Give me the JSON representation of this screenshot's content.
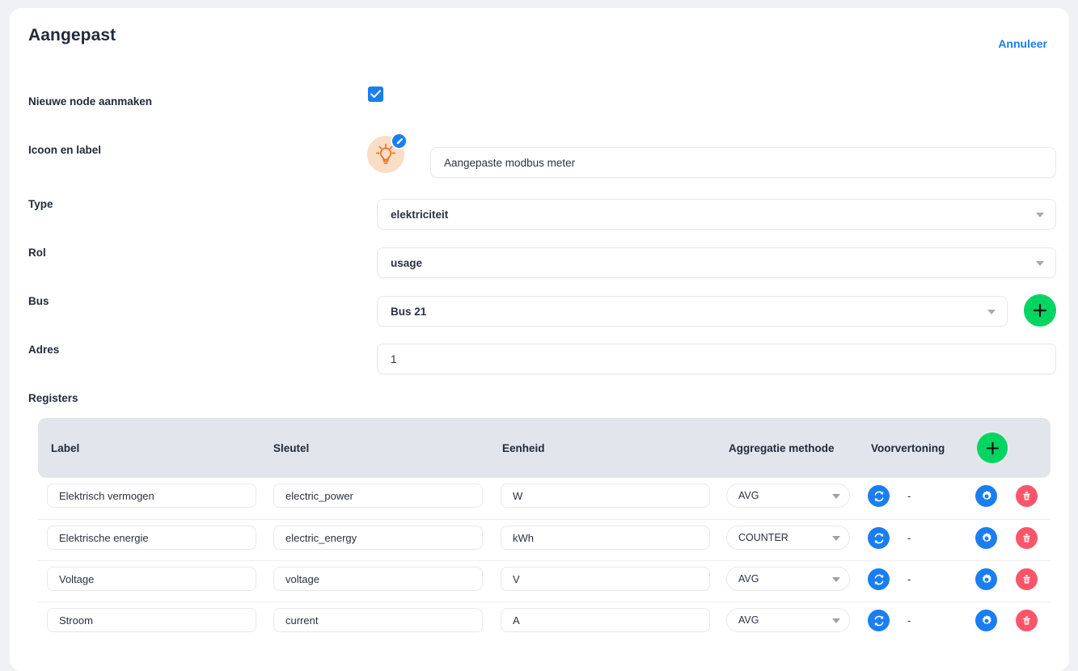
{
  "header": {
    "title": "Aangepast",
    "cancel_label": "Annuleer"
  },
  "form": {
    "new_node": {
      "label": "Nieuwe node aanmaken",
      "checked": true
    },
    "icon_and_label": {
      "label": "Icoon en label",
      "icon_name": "lightbulb-icon",
      "edit_badge_icon": "pencil-icon",
      "value": "Aangepaste modbus meter"
    },
    "type": {
      "label": "Type",
      "value": "elektriciteit"
    },
    "role": {
      "label": "Rol",
      "value": "usage"
    },
    "bus": {
      "label": "Bus",
      "value": "Bus 21",
      "add_button_icon": "plus-icon"
    },
    "address": {
      "label": "Adres",
      "value": "1"
    }
  },
  "registers": {
    "section_label": "Registers",
    "add_button_icon": "plus-icon",
    "columns": [
      "Label",
      "Sleutel",
      "Eenheid",
      "Aggregatie methode",
      "Voorvertoning"
    ],
    "rows": [
      {
        "label": "Elektrisch vermogen",
        "key": "electric_power",
        "unit": "W",
        "aggregation": "AVG",
        "preview": "-",
        "refresh_icon": "refresh-icon",
        "settings_icon": "gear-icon",
        "delete_icon": "trash-icon"
      },
      {
        "label": "Elektrische energie",
        "key": "electric_energy",
        "unit": "kWh",
        "aggregation": "COUNTER",
        "preview": "-",
        "refresh_icon": "refresh-icon",
        "settings_icon": "gear-icon",
        "delete_icon": "trash-icon"
      },
      {
        "label": "Voltage",
        "key": "voltage",
        "unit": "V",
        "aggregation": "AVG",
        "preview": "-",
        "refresh_icon": "refresh-icon",
        "settings_icon": "gear-icon",
        "delete_icon": "trash-icon"
      },
      {
        "label": "Stroom",
        "key": "current",
        "unit": "A",
        "aggregation": "AVG",
        "preview": "-",
        "refresh_icon": "refresh-icon",
        "settings_icon": "gear-icon",
        "delete_icon": "trash-icon"
      }
    ]
  },
  "colors": {
    "accent_blue": "#1a7ef0",
    "green": "#00d562",
    "red": "#fb5569",
    "icon_bg_peach": "#fbddc5",
    "icon_orange": "#f4701b",
    "header_row_bg": "#e2e6ec",
    "page_bg": "#f0f1f5",
    "text_dark": "#222b3c"
  }
}
